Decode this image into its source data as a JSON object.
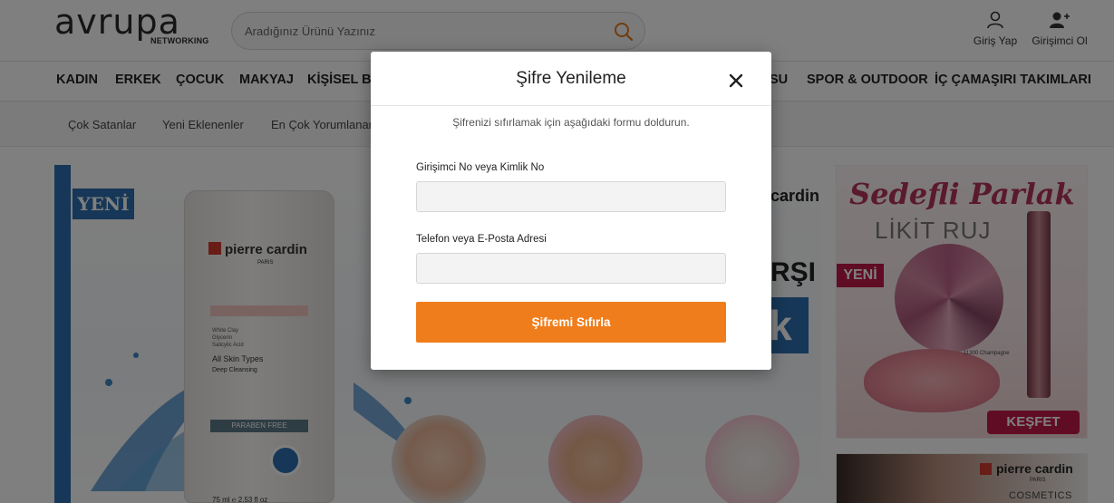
{
  "header": {
    "logo_text": "avrupa",
    "logo_sub": "NETWORKING",
    "search": {
      "placeholder": "Aradığınız Ürünü Yazınız"
    },
    "login_label": "Giriş Yap",
    "signup_label": "Girişimci Ol"
  },
  "nav": {
    "items": [
      "KADIN",
      "ERKEK",
      "ÇOCUK",
      "MAKYAJ",
      "KİŞİSEL BA",
      "SU",
      "SPOR & OUTDOOR",
      "İÇ ÇAMAŞIRI TAKIMLARI"
    ]
  },
  "subnav": {
    "items": [
      "Çok Satanlar",
      "Yeni Eklenenler",
      "En Çok Yorumlanan"
    ]
  },
  "banner": {
    "tag": "YENİ",
    "tube": {
      "brand": "pierre cardin",
      "paris": "PARIS",
      "ingredients": [
        "White Clay",
        "Glycerin",
        "Salicylic Acid"
      ],
      "skin": "All Skin Types",
      "deep": "Deep Cleansing",
      "paraben": "PARABEN FREE",
      "volume": "75 ml ℮ 2.53 fl oz"
    },
    "brand_right": "cardin",
    "big_text": "RŞI",
    "box_letter": "k"
  },
  "side_promo": {
    "title": "Sedefli Parlak",
    "subtitle": "LİKİT RUJ",
    "tag": "YENİ",
    "shade": "11300 Champagne",
    "cta": "KEŞFET"
  },
  "side_promo_2": {
    "brand": "pierre cardin",
    "paris": "PARIS",
    "cosmetics": "COSMETICS"
  },
  "modal": {
    "title": "Şifre Yenileme",
    "description": "Şifrenizi sıfırlamak için aşağıdaki formu doldurun.",
    "field1_label": "Girişimci No veya Kimlik No",
    "field1_value": "",
    "field2_label": "Telefon veya E-Posta Adresi",
    "field2_value": "",
    "submit_label": "Şifremi Sıfırla"
  },
  "colors": {
    "accent": "#f07d1b",
    "brand_blue": "#2d6fae",
    "promo_pink": "#c2184b"
  }
}
